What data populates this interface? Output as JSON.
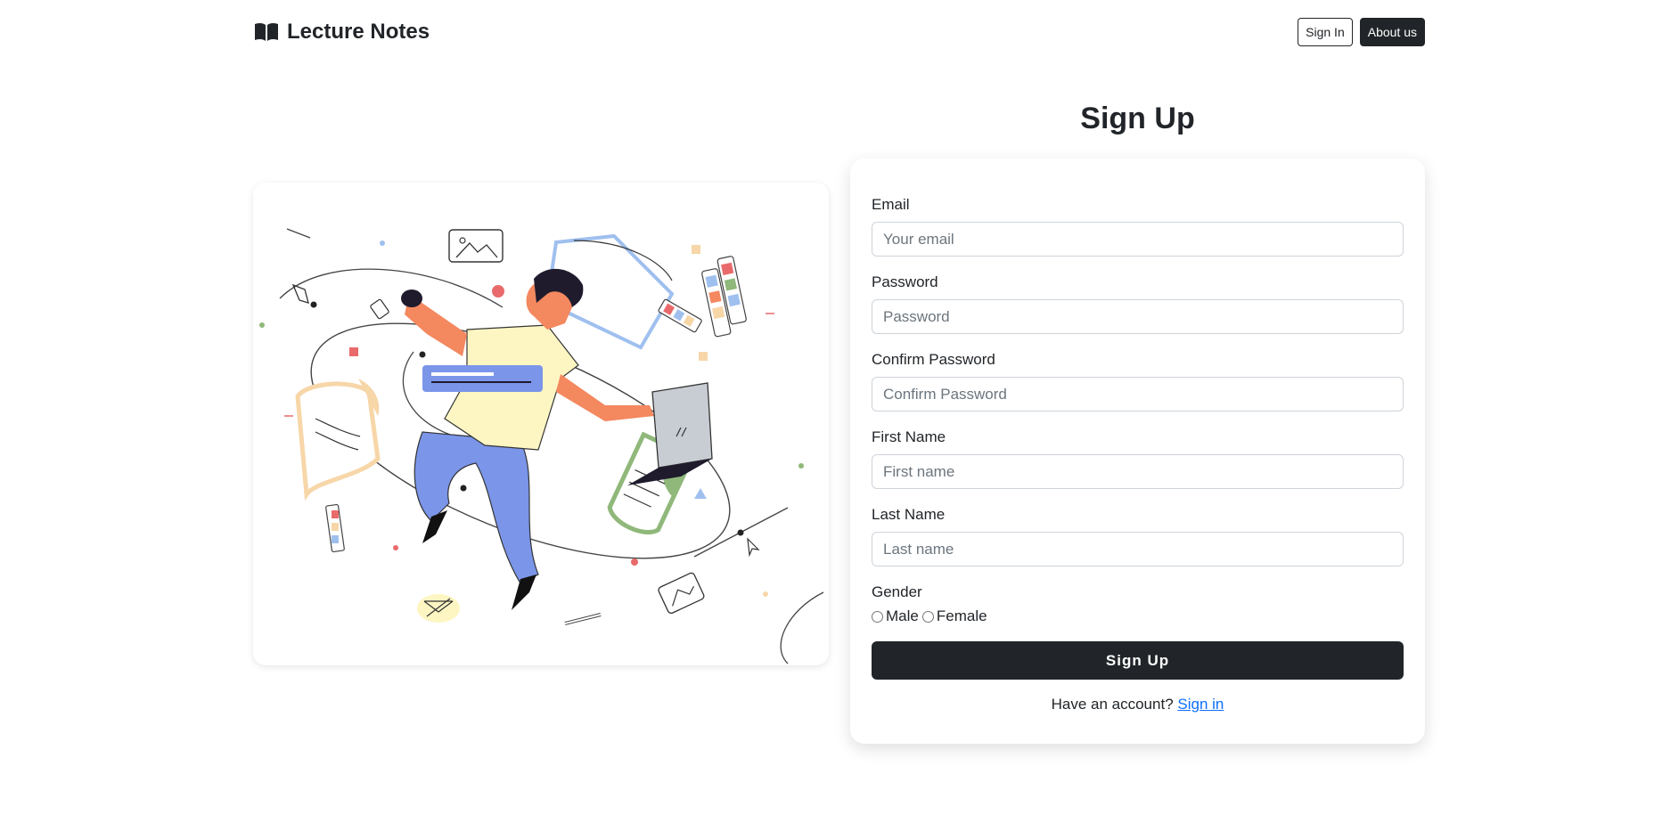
{
  "header": {
    "brand_icon": "open-book-icon",
    "brand": "Lecture Notes",
    "sign_in_label": "Sign In",
    "about_label": "About us"
  },
  "form": {
    "title": "Sign Up",
    "email_label": "Email",
    "email_placeholder": "Your email",
    "email_value": "",
    "password_label": "Password",
    "password_placeholder": "Password",
    "password_value": "",
    "confirm_label": "Confirm Password",
    "confirm_placeholder": "Confirm Password",
    "confirm_value": "",
    "first_name_label": "First Name",
    "first_name_placeholder": "First name",
    "first_name_value": "",
    "last_name_label": "Last Name",
    "last_name_placeholder": "Last name",
    "last_name_value": "",
    "gender_label": "Gender",
    "gender_options": [
      "Male",
      "Female"
    ],
    "submit_label": "Sign Up",
    "footer_text": "Have an account?",
    "footer_link": "Sign in"
  },
  "colors": {
    "primary_dark": "#212529",
    "link": "#0d6efd",
    "shirt": "#fdf6c3",
    "pants": "#7b95e9",
    "skin": "#f4885f",
    "hair": "#1f1b2d",
    "accent_green": "#8fb87a",
    "accent_peach": "#f7d6a8",
    "accent_red": "#e96a6a",
    "accent_blue": "#9fc0ef"
  }
}
